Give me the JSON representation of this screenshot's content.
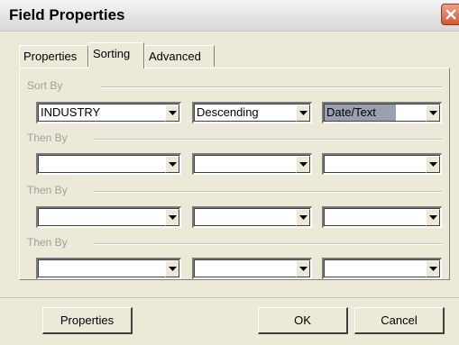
{
  "window": {
    "title": "Field Properties"
  },
  "tabs": [
    {
      "label": "Properties",
      "active": false
    },
    {
      "label": "Sorting",
      "active": true
    },
    {
      "label": "Advanced",
      "active": false
    }
  ],
  "groups": [
    {
      "label": "Sort By",
      "field": "INDUSTRY",
      "order": "Descending",
      "type": "Date/Text"
    },
    {
      "label": "Then By",
      "field": "",
      "order": "",
      "type": ""
    },
    {
      "label": "Then By",
      "field": "",
      "order": "",
      "type": ""
    },
    {
      "label": "Then By",
      "field": "",
      "order": "",
      "type": ""
    }
  ],
  "buttons": {
    "properties": "Properties",
    "ok": "OK",
    "cancel": "Cancel"
  },
  "colors": {
    "dialog_bg": "#ece9d8",
    "close_button": "#d9542f",
    "selected_combo_bg": "#9aa0b0",
    "group_label": "#a0a0a0"
  }
}
